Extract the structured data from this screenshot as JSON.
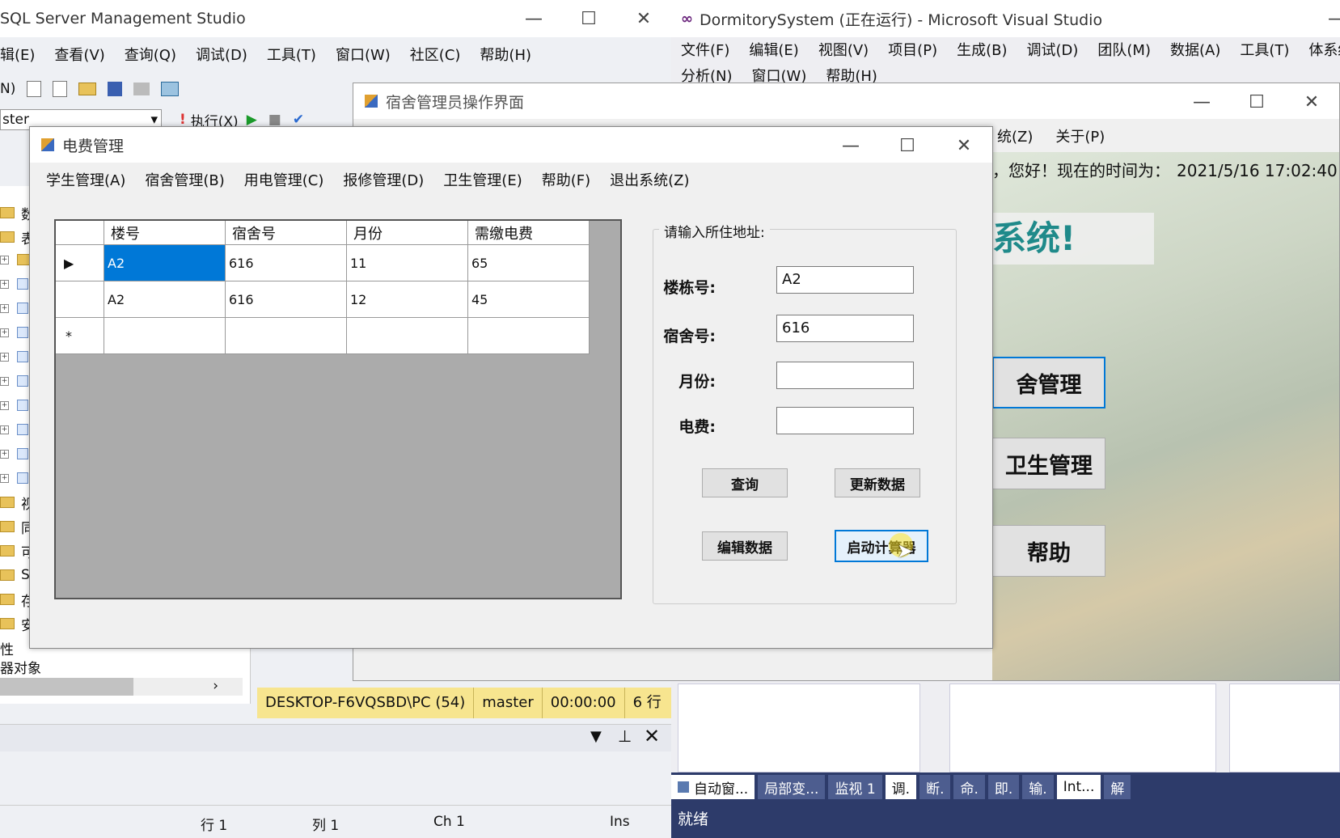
{
  "ssms": {
    "title": "SQL Server Management Studio",
    "menu": [
      "辑(E)",
      "查看(V)",
      "查询(Q)",
      "调试(D)",
      "工具(T)",
      "窗口(W)",
      "社区(C)",
      "帮助(H)"
    ],
    "toolbar_left": "N)",
    "db_combo": "ster",
    "execute_label": "执行(X)",
    "tree_items": [
      "数",
      "表",
      "视",
      "同",
      "可",
      "S",
      "存",
      "安全性"
    ],
    "tree_footer": [
      "性",
      "器对象"
    ],
    "status": [
      "DESKTOP-F6VQSBD\\PC (54)",
      "master",
      "00:00:00",
      "6 行"
    ],
    "bottom": {
      "row": "行 1",
      "col": "列 1",
      "ch": "Ch 1",
      "ins": "Ins"
    }
  },
  "vs": {
    "title": "DormitorySystem (正在运行) - Microsoft Visual Studio",
    "menu1": [
      "文件(F)",
      "编辑(E)",
      "视图(V)",
      "项目(P)",
      "生成(B)",
      "调试(D)",
      "团队(M)",
      "数据(A)",
      "工具(T)",
      "体系结构(C"
    ],
    "menu2": [
      "分析(N)",
      "窗口(W)",
      "帮助(H)"
    ],
    "tabs": [
      "自动窗...",
      "局部变...",
      "监视 1",
      "调.",
      "断.",
      "命.",
      "即.",
      "输.",
      "Int...",
      "解"
    ],
    "status": "就绪"
  },
  "dorm": {
    "title": "宿舍管理员操作界面",
    "menu": [
      "统(Z)",
      "关于(P)"
    ],
    "greeting": "，您好！现在的时间为：",
    "time": "2021/5/16 17:02:40",
    "banner": "系统!",
    "buttons": [
      "舍管理",
      "卫生管理",
      "帮助"
    ]
  },
  "elec": {
    "title": "电费管理",
    "menu": [
      "学生管理(A)",
      "宿舍管理(B)",
      "用电管理(C)",
      "报修管理(D)",
      "卫生管理(E)",
      "帮助(F)",
      "退出系统(Z)"
    ],
    "columns": [
      "楼号",
      "宿舍号",
      "月份",
      "需缴电费"
    ],
    "rows": [
      [
        "A2",
        "616",
        "11",
        "65"
      ],
      [
        "A2",
        "616",
        "12",
        "45"
      ]
    ],
    "group_label": "请输入所住地址:",
    "fields": {
      "building_label": "楼栋号:",
      "building_value": "A2",
      "room_label": "宿舍号:",
      "room_value": "616",
      "month_label": "月份:",
      "month_value": "",
      "fee_label": "电费:",
      "fee_value": ""
    },
    "buttons": {
      "query": "查询",
      "update": "更新数据",
      "edit": "编辑数据",
      "calc": "启动计算器"
    }
  }
}
